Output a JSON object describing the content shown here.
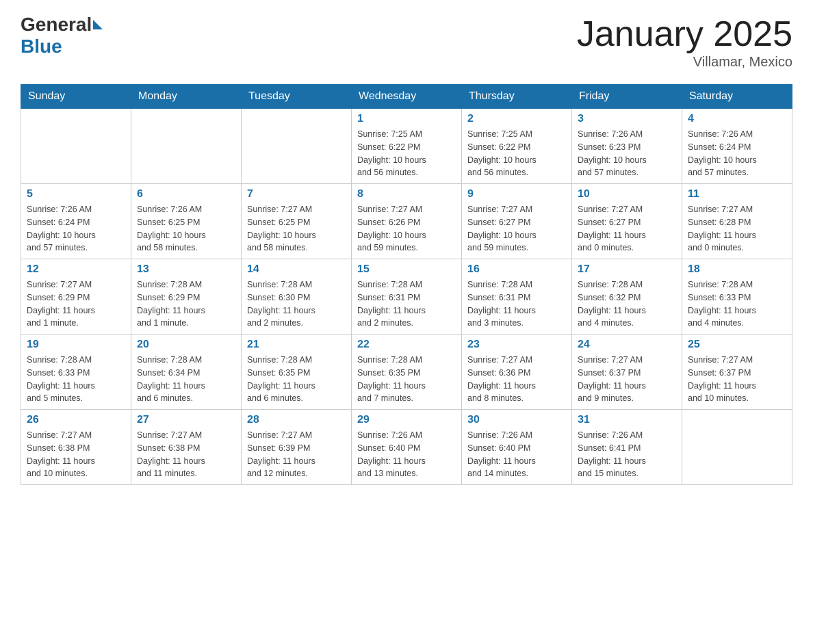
{
  "logo": {
    "general": "General",
    "blue": "Blue"
  },
  "title": "January 2025",
  "location": "Villamar, Mexico",
  "days_header": [
    "Sunday",
    "Monday",
    "Tuesday",
    "Wednesday",
    "Thursday",
    "Friday",
    "Saturday"
  ],
  "weeks": [
    [
      {
        "day": "",
        "detail": ""
      },
      {
        "day": "",
        "detail": ""
      },
      {
        "day": "",
        "detail": ""
      },
      {
        "day": "1",
        "detail": "Sunrise: 7:25 AM\nSunset: 6:22 PM\nDaylight: 10 hours\nand 56 minutes."
      },
      {
        "day": "2",
        "detail": "Sunrise: 7:25 AM\nSunset: 6:22 PM\nDaylight: 10 hours\nand 56 minutes."
      },
      {
        "day": "3",
        "detail": "Sunrise: 7:26 AM\nSunset: 6:23 PM\nDaylight: 10 hours\nand 57 minutes."
      },
      {
        "day": "4",
        "detail": "Sunrise: 7:26 AM\nSunset: 6:24 PM\nDaylight: 10 hours\nand 57 minutes."
      }
    ],
    [
      {
        "day": "5",
        "detail": "Sunrise: 7:26 AM\nSunset: 6:24 PM\nDaylight: 10 hours\nand 57 minutes."
      },
      {
        "day": "6",
        "detail": "Sunrise: 7:26 AM\nSunset: 6:25 PM\nDaylight: 10 hours\nand 58 minutes."
      },
      {
        "day": "7",
        "detail": "Sunrise: 7:27 AM\nSunset: 6:25 PM\nDaylight: 10 hours\nand 58 minutes."
      },
      {
        "day": "8",
        "detail": "Sunrise: 7:27 AM\nSunset: 6:26 PM\nDaylight: 10 hours\nand 59 minutes."
      },
      {
        "day": "9",
        "detail": "Sunrise: 7:27 AM\nSunset: 6:27 PM\nDaylight: 10 hours\nand 59 minutes."
      },
      {
        "day": "10",
        "detail": "Sunrise: 7:27 AM\nSunset: 6:27 PM\nDaylight: 11 hours\nand 0 minutes."
      },
      {
        "day": "11",
        "detail": "Sunrise: 7:27 AM\nSunset: 6:28 PM\nDaylight: 11 hours\nand 0 minutes."
      }
    ],
    [
      {
        "day": "12",
        "detail": "Sunrise: 7:27 AM\nSunset: 6:29 PM\nDaylight: 11 hours\nand 1 minute."
      },
      {
        "day": "13",
        "detail": "Sunrise: 7:28 AM\nSunset: 6:29 PM\nDaylight: 11 hours\nand 1 minute."
      },
      {
        "day": "14",
        "detail": "Sunrise: 7:28 AM\nSunset: 6:30 PM\nDaylight: 11 hours\nand 2 minutes."
      },
      {
        "day": "15",
        "detail": "Sunrise: 7:28 AM\nSunset: 6:31 PM\nDaylight: 11 hours\nand 2 minutes."
      },
      {
        "day": "16",
        "detail": "Sunrise: 7:28 AM\nSunset: 6:31 PM\nDaylight: 11 hours\nand 3 minutes."
      },
      {
        "day": "17",
        "detail": "Sunrise: 7:28 AM\nSunset: 6:32 PM\nDaylight: 11 hours\nand 4 minutes."
      },
      {
        "day": "18",
        "detail": "Sunrise: 7:28 AM\nSunset: 6:33 PM\nDaylight: 11 hours\nand 4 minutes."
      }
    ],
    [
      {
        "day": "19",
        "detail": "Sunrise: 7:28 AM\nSunset: 6:33 PM\nDaylight: 11 hours\nand 5 minutes."
      },
      {
        "day": "20",
        "detail": "Sunrise: 7:28 AM\nSunset: 6:34 PM\nDaylight: 11 hours\nand 6 minutes."
      },
      {
        "day": "21",
        "detail": "Sunrise: 7:28 AM\nSunset: 6:35 PM\nDaylight: 11 hours\nand 6 minutes."
      },
      {
        "day": "22",
        "detail": "Sunrise: 7:28 AM\nSunset: 6:35 PM\nDaylight: 11 hours\nand 7 minutes."
      },
      {
        "day": "23",
        "detail": "Sunrise: 7:27 AM\nSunset: 6:36 PM\nDaylight: 11 hours\nand 8 minutes."
      },
      {
        "day": "24",
        "detail": "Sunrise: 7:27 AM\nSunset: 6:37 PM\nDaylight: 11 hours\nand 9 minutes."
      },
      {
        "day": "25",
        "detail": "Sunrise: 7:27 AM\nSunset: 6:37 PM\nDaylight: 11 hours\nand 10 minutes."
      }
    ],
    [
      {
        "day": "26",
        "detail": "Sunrise: 7:27 AM\nSunset: 6:38 PM\nDaylight: 11 hours\nand 10 minutes."
      },
      {
        "day": "27",
        "detail": "Sunrise: 7:27 AM\nSunset: 6:38 PM\nDaylight: 11 hours\nand 11 minutes."
      },
      {
        "day": "28",
        "detail": "Sunrise: 7:27 AM\nSunset: 6:39 PM\nDaylight: 11 hours\nand 12 minutes."
      },
      {
        "day": "29",
        "detail": "Sunrise: 7:26 AM\nSunset: 6:40 PM\nDaylight: 11 hours\nand 13 minutes."
      },
      {
        "day": "30",
        "detail": "Sunrise: 7:26 AM\nSunset: 6:40 PM\nDaylight: 11 hours\nand 14 minutes."
      },
      {
        "day": "31",
        "detail": "Sunrise: 7:26 AM\nSunset: 6:41 PM\nDaylight: 11 hours\nand 15 minutes."
      },
      {
        "day": "",
        "detail": ""
      }
    ]
  ]
}
